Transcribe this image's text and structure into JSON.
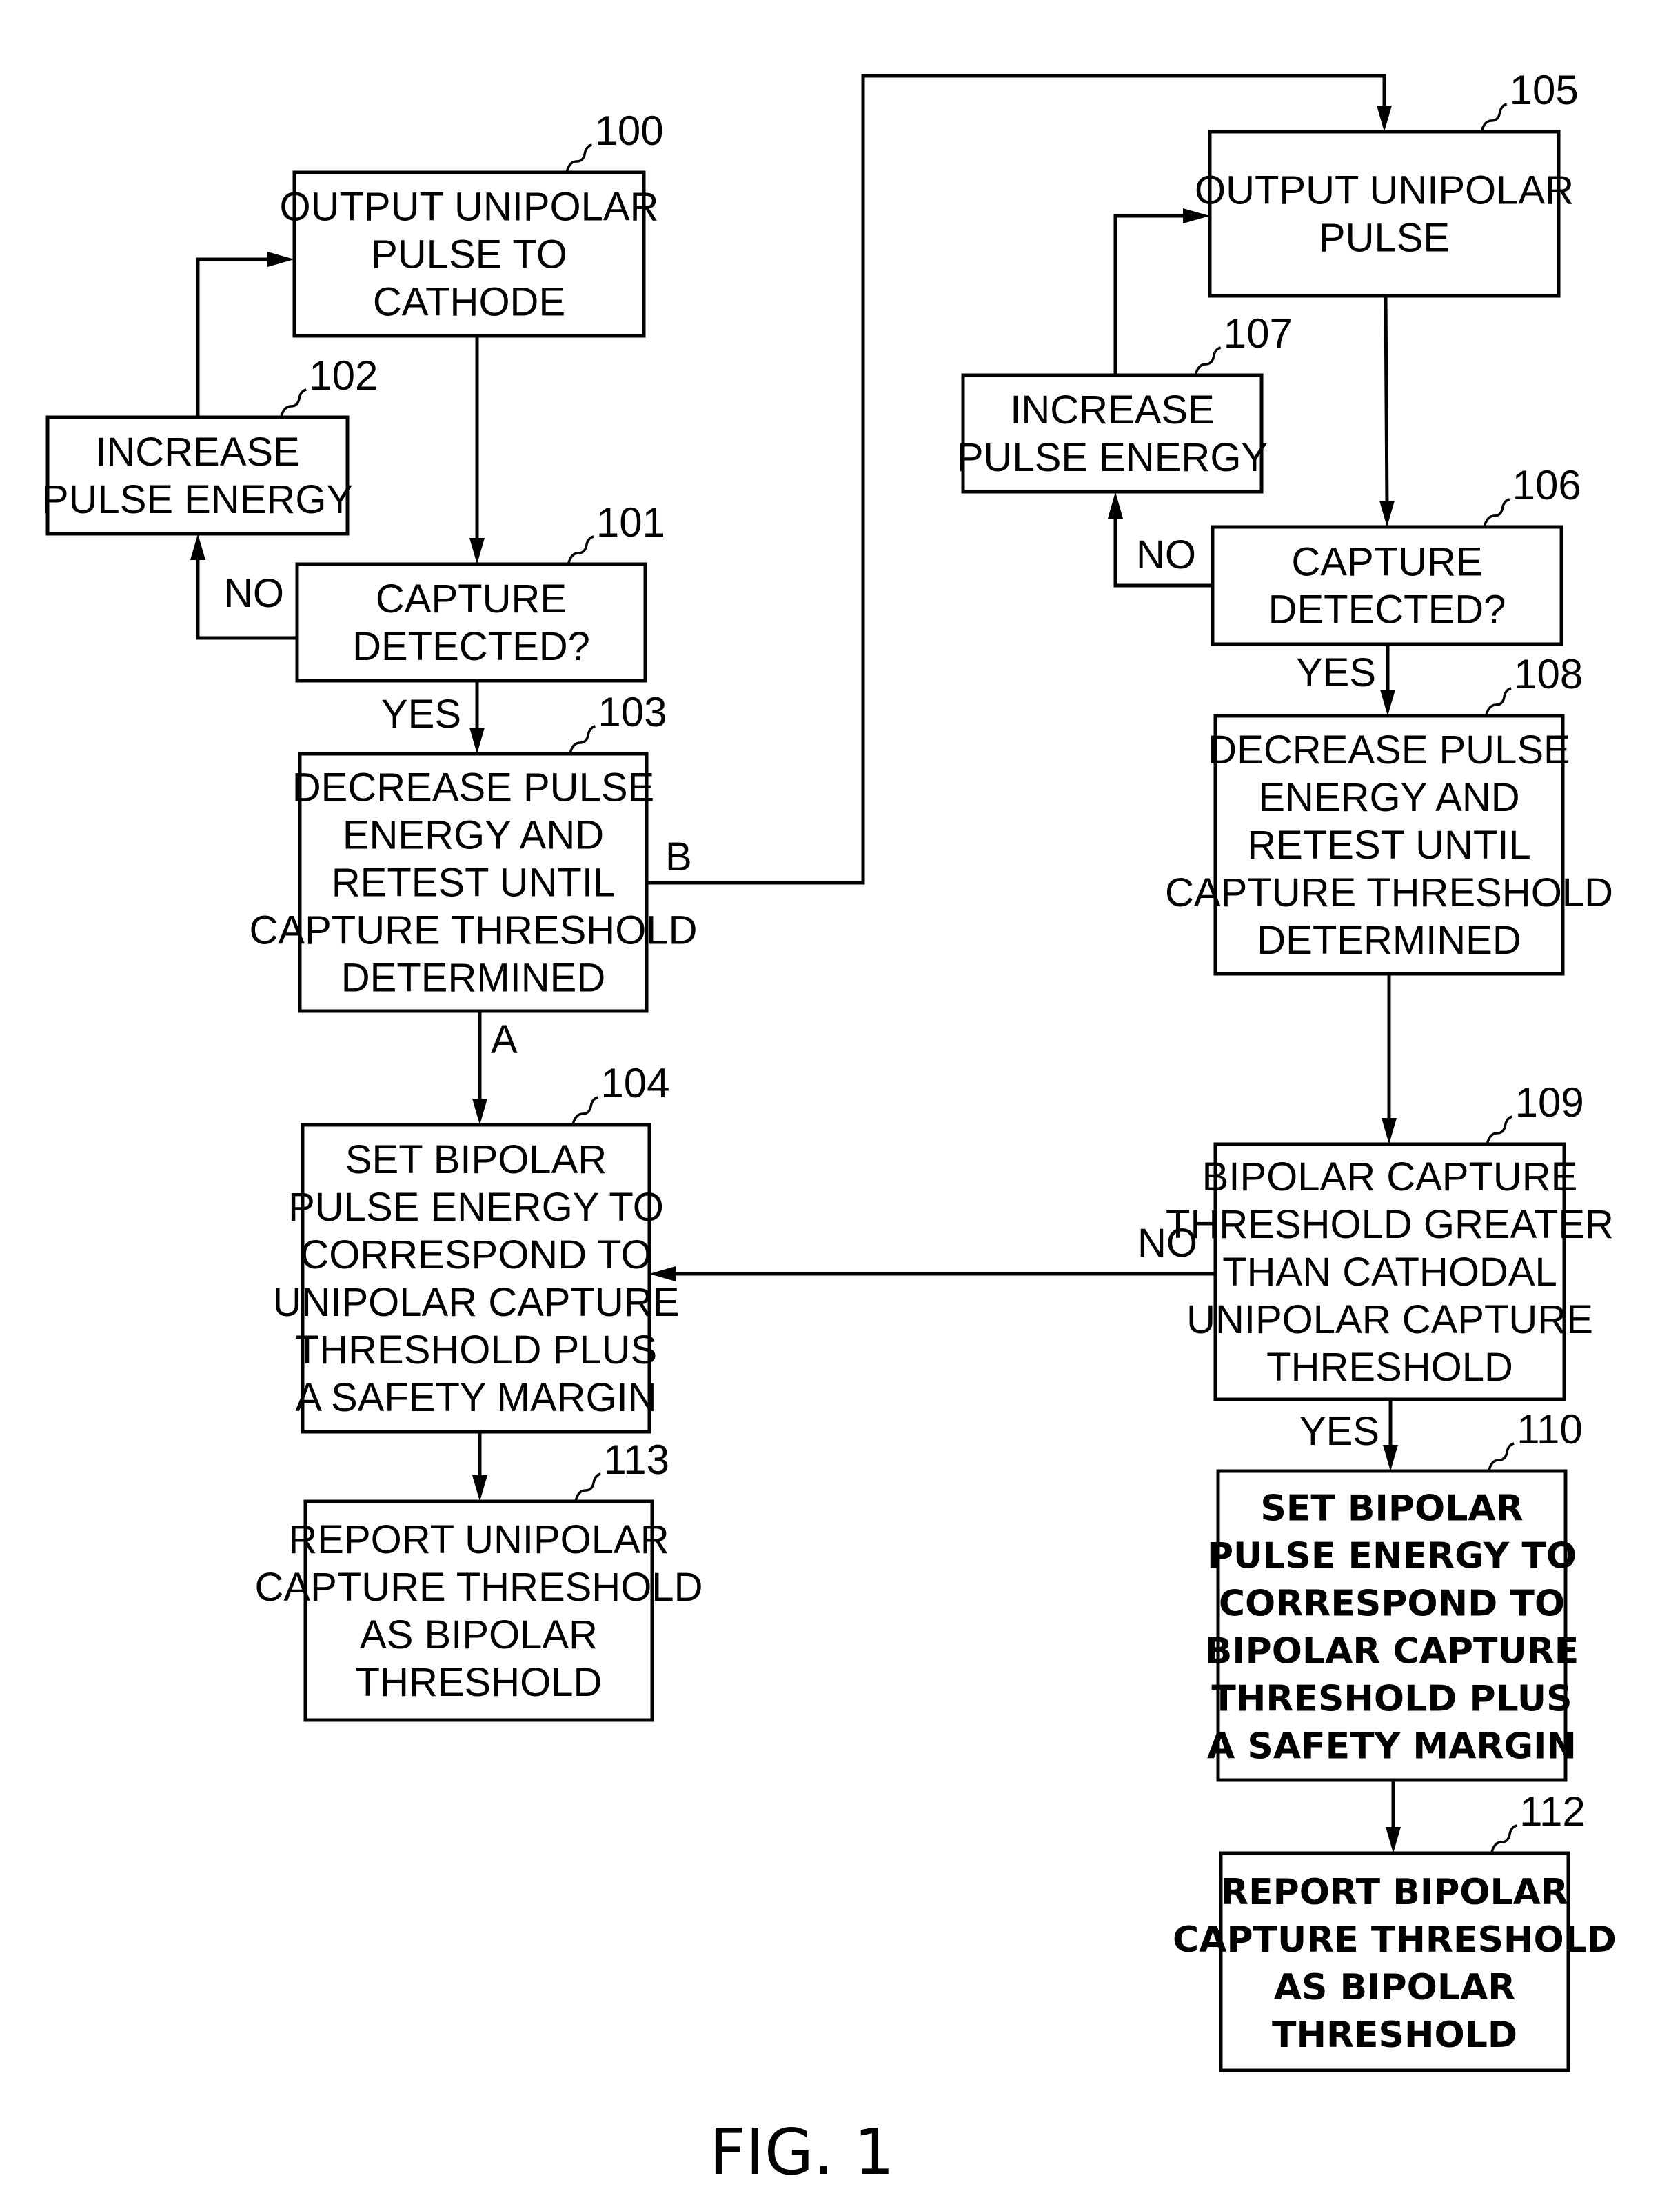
{
  "figure": {
    "caption": "FIG. 1",
    "type": "flowchart"
  },
  "nodes": {
    "n100": {
      "ref": "100",
      "lines": [
        "OUTPUT UNIPOLAR",
        "PULSE TO",
        "CATHODE"
      ]
    },
    "n101": {
      "ref": "101",
      "lines": [
        "CAPTURE",
        "DETECTED?"
      ]
    },
    "n102": {
      "ref": "102",
      "lines": [
        "INCREASE",
        "PULSE ENERGY"
      ]
    },
    "n103": {
      "ref": "103",
      "lines": [
        "DECREASE PULSE",
        "ENERGY AND",
        "RETEST UNTIL",
        "CAPTURE THRESHOLD",
        "DETERMINED"
      ]
    },
    "n104": {
      "ref": "104",
      "lines": [
        "SET BIPOLAR",
        "PULSE ENERGY TO",
        "CORRESPOND TO",
        "UNIPOLAR CAPTURE",
        "THRESHOLD PLUS",
        "A SAFETY MARGIN"
      ]
    },
    "n113": {
      "ref": "113",
      "lines": [
        "REPORT UNIPOLAR",
        "CAPTURE THRESHOLD",
        "AS BIPOLAR",
        "THRESHOLD"
      ]
    },
    "n105": {
      "ref": "105",
      "lines": [
        "OUTPUT UNIPOLAR",
        "PULSE"
      ]
    },
    "n106": {
      "ref": "106",
      "lines": [
        "CAPTURE",
        "DETECTED?"
      ]
    },
    "n107": {
      "ref": "107",
      "lines": [
        "INCREASE",
        "PULSE ENERGY"
      ]
    },
    "n108": {
      "ref": "108",
      "lines": [
        "DECREASE PULSE",
        "ENERGY AND",
        "RETEST UNTIL",
        "CAPTURE THRESHOLD",
        "DETERMINED"
      ]
    },
    "n109": {
      "ref": "109",
      "lines": [
        "BIPOLAR CAPTURE",
        "THRESHOLD GREATER",
        "THAN CATHODAL",
        "UNIPOLAR CAPTURE",
        "THRESHOLD"
      ]
    },
    "n110": {
      "ref": "110",
      "lines": [
        "SET BIPOLAR",
        "PULSE ENERGY TO",
        "CORRESPOND TO",
        "BIPOLAR CAPTURE",
        "THRESHOLD PLUS",
        "A SAFETY MARGIN"
      ]
    },
    "n112": {
      "ref": "112",
      "lines": [
        "REPORT BIPOLAR",
        "CAPTURE THRESHOLD",
        "AS BIPOLAR",
        "THRESHOLD"
      ]
    }
  },
  "edge_labels": {
    "n101_no": "NO",
    "n101_yes": "YES",
    "n103_a": "A",
    "n103_b": "B",
    "n106_no": "NO",
    "n106_yes": "YES",
    "n109_no": "NO",
    "n109_yes": "YES"
  },
  "edges": [
    {
      "from": "100",
      "to": "101"
    },
    {
      "from": "101",
      "to": "102",
      "label": "NO"
    },
    {
      "from": "102",
      "to": "100"
    },
    {
      "from": "101",
      "to": "103",
      "label": "YES"
    },
    {
      "from": "103",
      "to": "104",
      "label": "A"
    },
    {
      "from": "103",
      "to": "105",
      "label": "B"
    },
    {
      "from": "104",
      "to": "113"
    },
    {
      "from": "105",
      "to": "106"
    },
    {
      "from": "106",
      "to": "107",
      "label": "NO"
    },
    {
      "from": "107",
      "to": "105"
    },
    {
      "from": "106",
      "to": "108",
      "label": "YES"
    },
    {
      "from": "108",
      "to": "109"
    },
    {
      "from": "109",
      "to": "104",
      "label": "NO"
    },
    {
      "from": "109",
      "to": "110",
      "label": "YES"
    },
    {
      "from": "110",
      "to": "112"
    }
  ]
}
